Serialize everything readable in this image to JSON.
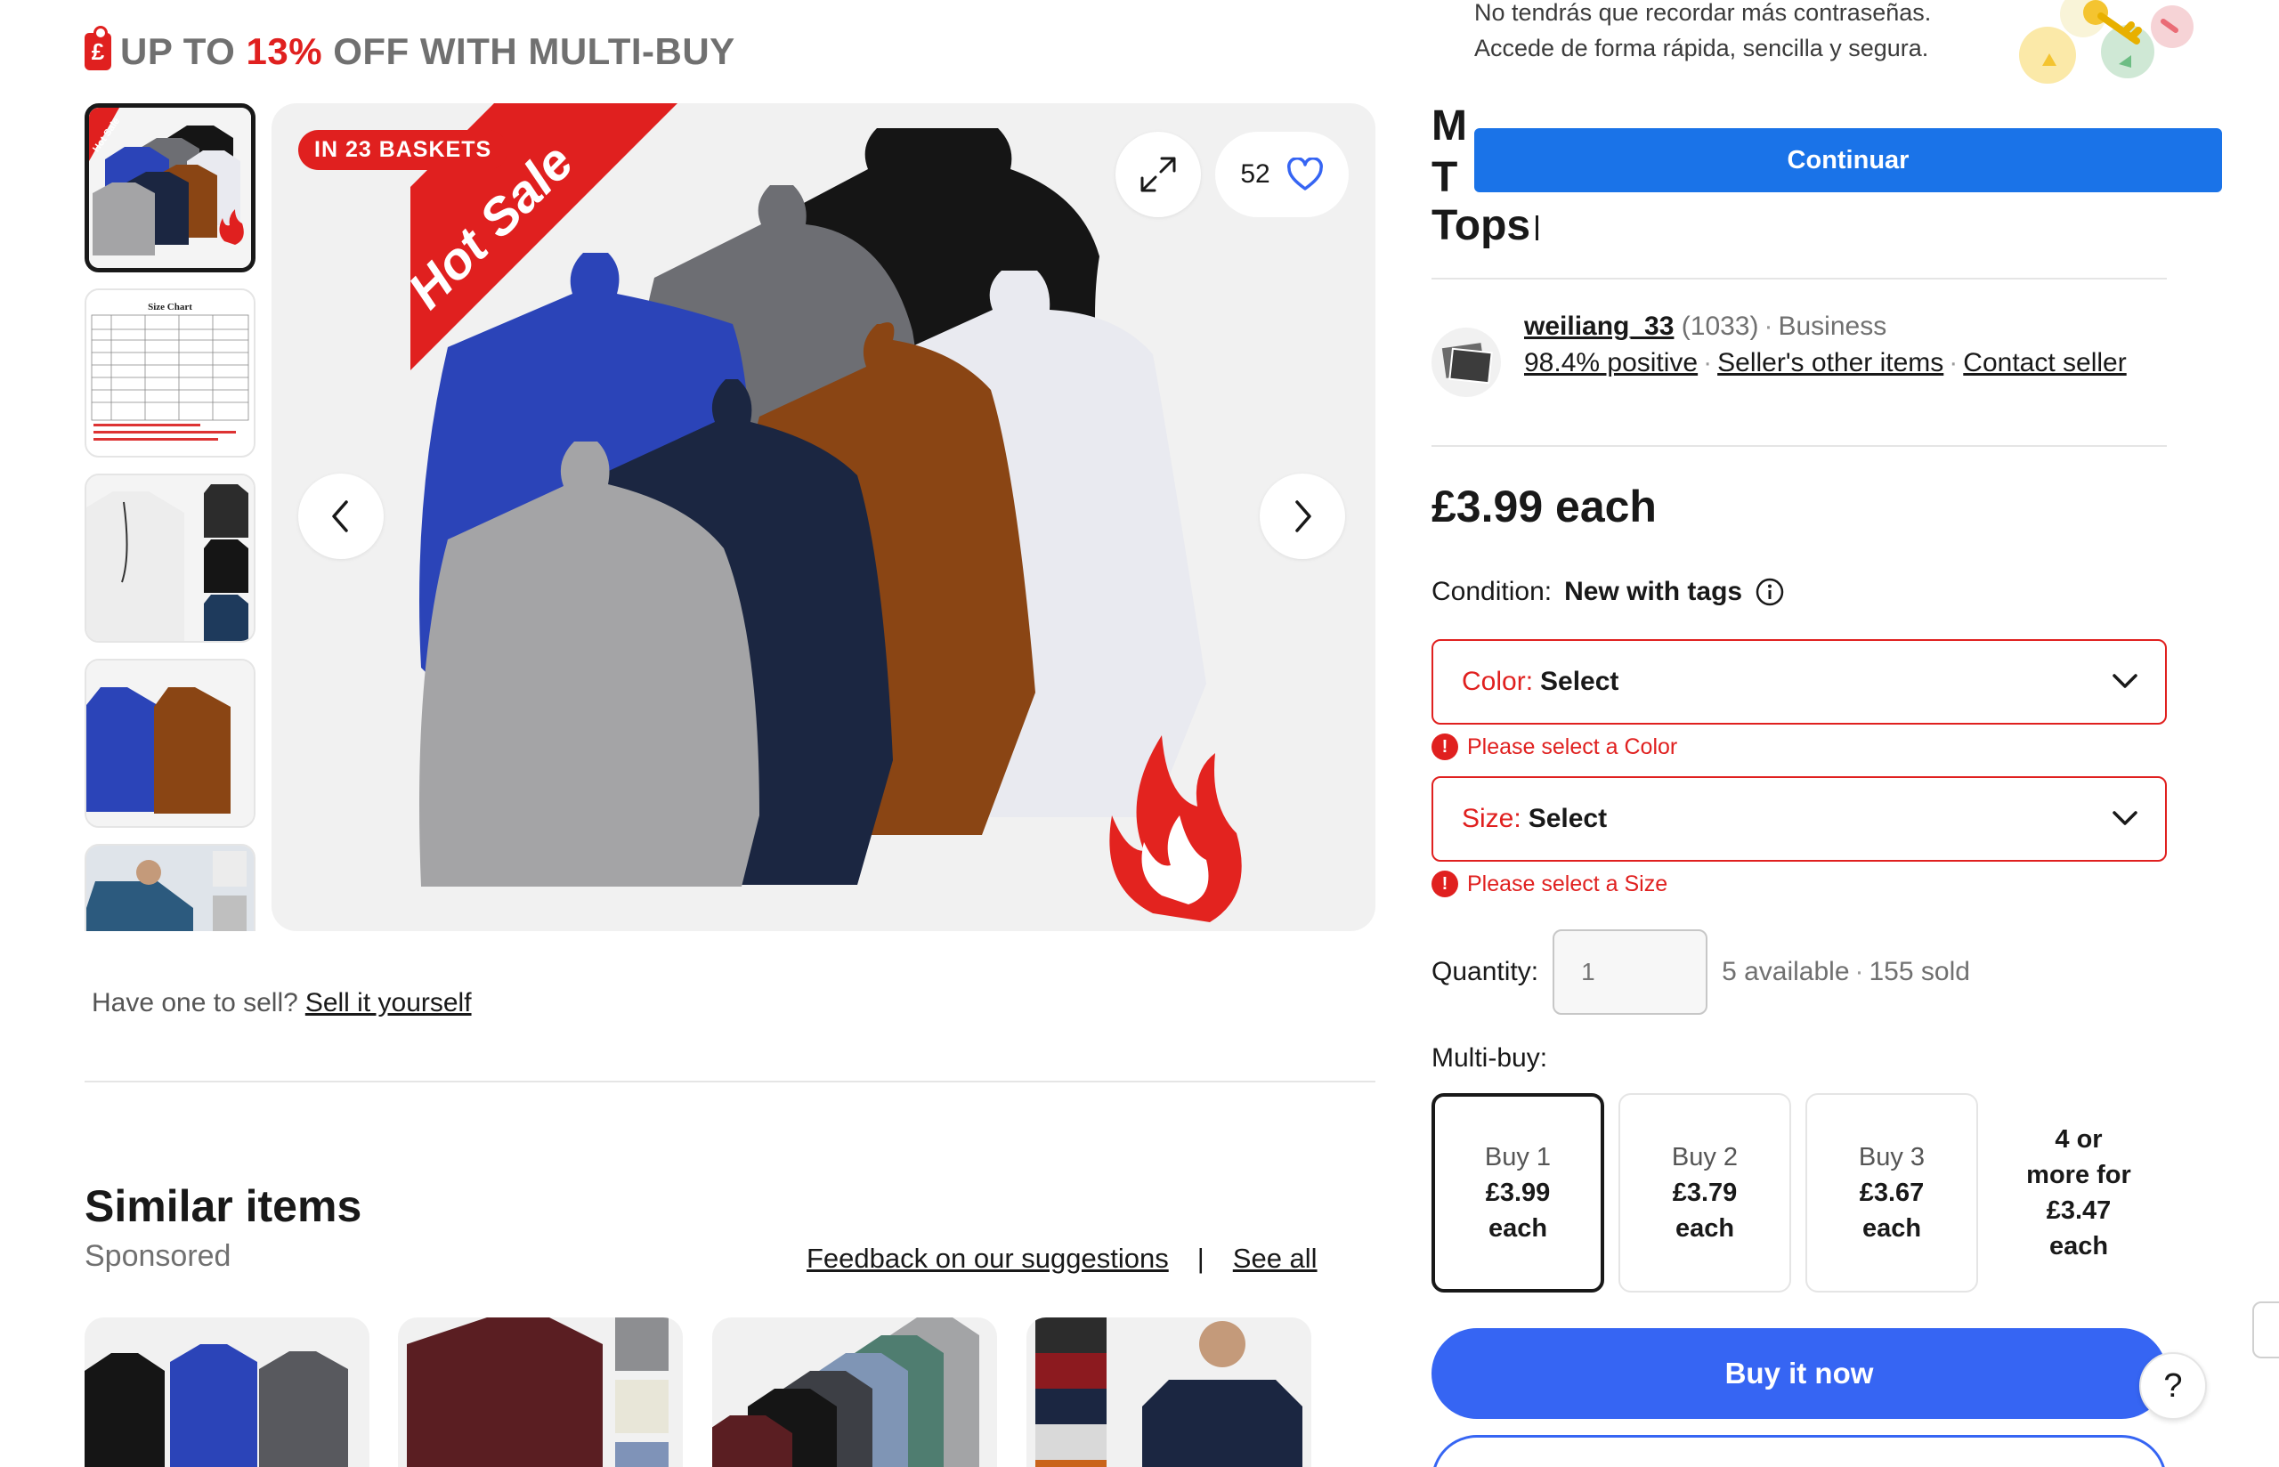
{
  "promo": {
    "prefix": "UP TO ",
    "percent": "13%",
    "suffix": " OFF WITH MULTI-BUY",
    "tag_symbol": "£"
  },
  "gallery": {
    "baskets_badge": "IN 23 BASKETS",
    "ribbon_text": "Hot Sale",
    "thumb_ribbon_text": "Hot Sale",
    "size_chart_title": "Size Chart",
    "watchers": "52",
    "expand_icon": "expand-icon",
    "heart_icon": "heart-icon",
    "prev_icon": "chevron-left-icon",
    "next_icon": "chevron-right-icon",
    "colors": [
      "#2b44b8",
      "#6d6e73",
      "#151515",
      "#1b2641",
      "#8a4514",
      "#e9eaf0",
      "#a4a4a6"
    ]
  },
  "sell": {
    "question": "Have one to sell?",
    "link": "Sell it yourself"
  },
  "similar": {
    "title": "Similar items",
    "sponsored": "Sponsored",
    "feedback_link": "Feedback on our suggestions",
    "separator": "|",
    "see_all": "See all"
  },
  "passkey": {
    "message": "No tendrás que recordar más contraseñas. Accede de forma rápida, sencilla y segura.",
    "button": "Continuar"
  },
  "listing": {
    "title_fragments": [
      "M",
      "T",
      "Tops"
    ]
  },
  "seller": {
    "name": "weiliang_33",
    "feedback_count": "(1033)",
    "type": "Business",
    "positive": "98.4% positive",
    "other_items": "Seller's other items",
    "contact": "Contact seller",
    "dot": "·"
  },
  "price": "£3.99 each",
  "condition": {
    "label": "Condition:",
    "value": "New with tags",
    "icon": "info-icon"
  },
  "variations": {
    "color": {
      "label": "Color:",
      "value": "Select",
      "error": "Please select a Color"
    },
    "size": {
      "label": "Size:",
      "value": "Select",
      "error": "Please select a Size"
    }
  },
  "quantity": {
    "label": "Quantity:",
    "placeholder": "1",
    "available": "5 available",
    "sold": "155 sold"
  },
  "multibuy": {
    "label": "Multi-buy:",
    "options": [
      {
        "qty": "Buy 1",
        "price": "£3.99",
        "unit": "each"
      },
      {
        "qty": "Buy 2",
        "price": "£3.79",
        "unit": "each"
      },
      {
        "qty": "Buy 3",
        "price": "£3.67",
        "unit": "each"
      },
      {
        "qty": "4 or",
        "qty2": "more for",
        "price": "£3.47",
        "unit": "each"
      }
    ]
  },
  "buy_now": "Buy it now",
  "help": "?",
  "accent_colors": {
    "ebay_blue": "#3665f3",
    "google_blue": "#1a73e8",
    "error_red": "#e0201f"
  }
}
